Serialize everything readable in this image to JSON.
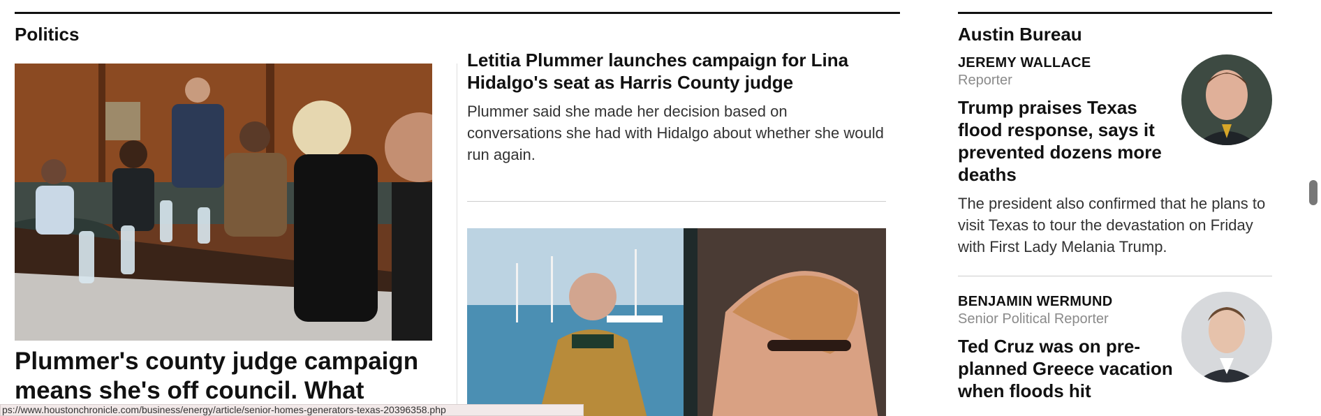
{
  "politics": {
    "section_title": "Politics",
    "lead": {
      "headline": "Plummer's county judge campaign means she's off council. What"
    },
    "secondary": {
      "headline": "Letitia Plummer launches campaign for Lina Hidalgo's seat as Harris County judge",
      "dek": "Plummer said she made her decision based on conversations she had with Hidalgo about whether she would run again."
    }
  },
  "austin_bureau": {
    "section_title": "Austin Bureau",
    "stories": [
      {
        "author": "JEREMY WALLACE",
        "role": "Reporter",
        "headline": "Trump praises Texas flood response, says it prevented dozens more deaths",
        "dek": "The president also confirmed that he plans to visit Texas to tour the devastation on Friday with First Lady Melania Trump."
      },
      {
        "author": "BENJAMIN WERMUND",
        "role": "Senior Political Reporter",
        "headline": "Ted Cruz was on pre-planned Greece vacation when floods hit"
      }
    ]
  },
  "status_bar": {
    "url": "ps://www.houstonchronicle.com/business/energy/article/senior-homes-generators-texas-20396358.php"
  }
}
